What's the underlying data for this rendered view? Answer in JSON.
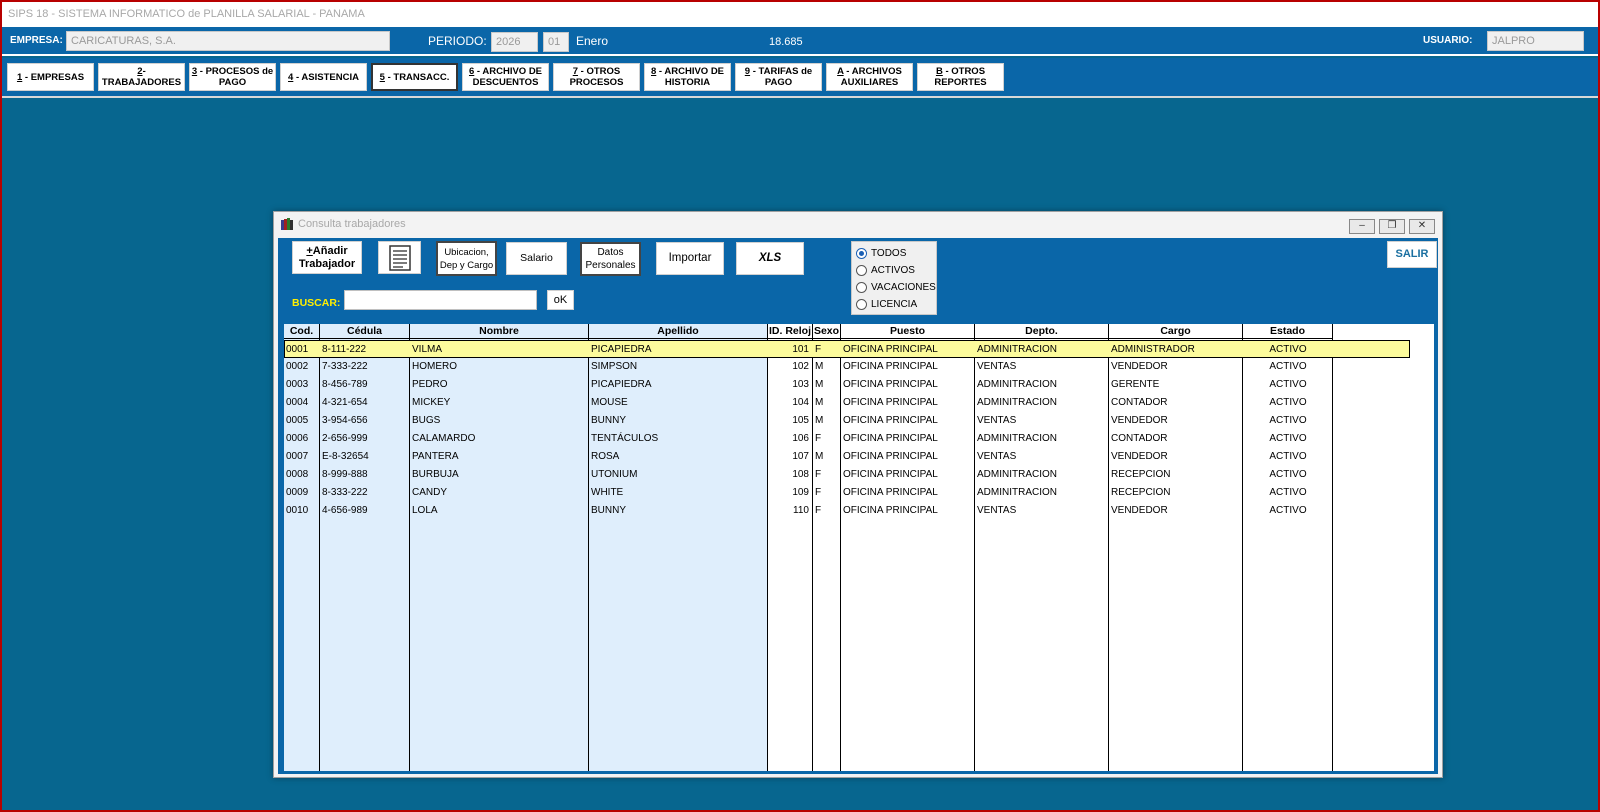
{
  "app": {
    "title": "SIPS 18 - SISTEMA INFORMATICO de PLANILLA SALARIAL - PANAMA"
  },
  "empresa_bar": {
    "empresa_label": "EMPRESA:",
    "empresa_value": "CARICATURAS, S.A.",
    "periodo_label": "PERIODO:",
    "periodo_year": "2026",
    "periodo_month": "01",
    "periodo_month_name": "Enero",
    "rate": "18.685",
    "usuario_label": "USUARIO:",
    "usuario_value": "JALPRO"
  },
  "menu": [
    {
      "key": "1",
      "label": " - EMPRESAS"
    },
    {
      "key": "2",
      "label": "-TRABAJADORES"
    },
    {
      "key": "3",
      "label": " - PROCESOS de\nPAGO"
    },
    {
      "key": "4",
      "label": " - ASISTENCIA"
    },
    {
      "key": "5",
      "label": " - TRANSACC."
    },
    {
      "key": "6",
      "label": " - ARCHIVO DE\nDESCUENTOS"
    },
    {
      "key": "7",
      "label": " - OTROS\nPROCESOS"
    },
    {
      "key": "8",
      "label": " - ARCHIVO DE\nHISTORIA"
    },
    {
      "key": "9",
      "label": " - TARIFAS de\nPAGO"
    },
    {
      "key": "A",
      "label": " - ARCHIVOS\nAUXILIARES"
    },
    {
      "key": "B",
      "label": " - OTROS\nREPORTES"
    }
  ],
  "dialog": {
    "title": "Consulta trabajadores",
    "toolbar": {
      "add_key": "+",
      "add_label": "Añadir\nTrabajador",
      "ubicacion": "Ubicacion,\nDep y Cargo",
      "salario": "Salario",
      "datos": "Datos\nPersonales",
      "importar": "Importar",
      "xls": "XLS",
      "salir": "SALIR"
    },
    "filters": [
      {
        "label": "TODOS",
        "checked": true
      },
      {
        "label": "ACTIVOS",
        "checked": false
      },
      {
        "label": "VACACIONES",
        "checked": false
      },
      {
        "label": "LICENCIA",
        "checked": false
      }
    ],
    "search": {
      "label": "BUSCAR:",
      "value": "",
      "ok_label": "oK"
    },
    "table": {
      "columns": [
        "Cod.",
        "Cédula",
        "Nombre",
        "Apellido",
        "ID. Reloj",
        "Sexo",
        "Puesto",
        "Depto.",
        "Cargo",
        "Estado"
      ],
      "rows": [
        [
          "0001",
          "8-111-222",
          "VILMA",
          "PICAPIEDRA",
          "101",
          "F",
          "OFICINA PRINCIPAL",
          "ADMINITRACION",
          "ADMINISTRADOR",
          "ACTIVO"
        ],
        [
          "0002",
          "7-333-222",
          "HOMERO",
          "SIMPSON",
          "102",
          "M",
          "OFICINA PRINCIPAL",
          "VENTAS",
          "VENDEDOR",
          "ACTIVO"
        ],
        [
          "0003",
          "8-456-789",
          "PEDRO",
          "PICAPIEDRA",
          "103",
          "M",
          "OFICINA PRINCIPAL",
          "ADMINITRACION",
          "GERENTE",
          "ACTIVO"
        ],
        [
          "0004",
          "4-321-654",
          "MICKEY",
          "MOUSE",
          "104",
          "M",
          "OFICINA PRINCIPAL",
          "ADMINITRACION",
          "CONTADOR",
          "ACTIVO"
        ],
        [
          "0005",
          "3-954-656",
          "BUGS",
          "BUNNY",
          "105",
          "M",
          "OFICINA PRINCIPAL",
          "VENTAS",
          "VENDEDOR",
          "ACTIVO"
        ],
        [
          "0006",
          "2-656-999",
          "CALAMARDO",
          "TENTÁCULOS",
          "106",
          "F",
          "OFICINA PRINCIPAL",
          "ADMINITRACION",
          "CONTADOR",
          "ACTIVO"
        ],
        [
          "0007",
          "E-8-32654",
          "PANTERA",
          "ROSA",
          "107",
          "M",
          "OFICINA PRINCIPAL",
          "VENTAS",
          "VENDEDOR",
          "ACTIVO"
        ],
        [
          "0008",
          "8-999-888",
          "BURBUJA",
          "UTONIUM",
          "108",
          "F",
          "OFICINA PRINCIPAL",
          "ADMINITRACION",
          "RECEPCION",
          "ACTIVO"
        ],
        [
          "0009",
          "8-333-222",
          "CANDY",
          "WHITE",
          "109",
          "F",
          "OFICINA PRINCIPAL",
          "ADMINITRACION",
          "RECEPCION",
          "ACTIVO"
        ],
        [
          "0010",
          "4-656-989",
          "LOLA",
          "BUNNY",
          "110",
          "F",
          "OFICINA PRINCIPAL",
          "VENTAS",
          "VENDEDOR",
          "ACTIVO"
        ]
      ],
      "selected_row": 0
    }
  },
  "colors": {
    "background": "#07668f",
    "bar": "#0a66a8",
    "search_label": "#ffef00",
    "selected_row": "#fcfb9c",
    "light_column": "#dfeefc",
    "salir_text": "#1a6fa0"
  }
}
